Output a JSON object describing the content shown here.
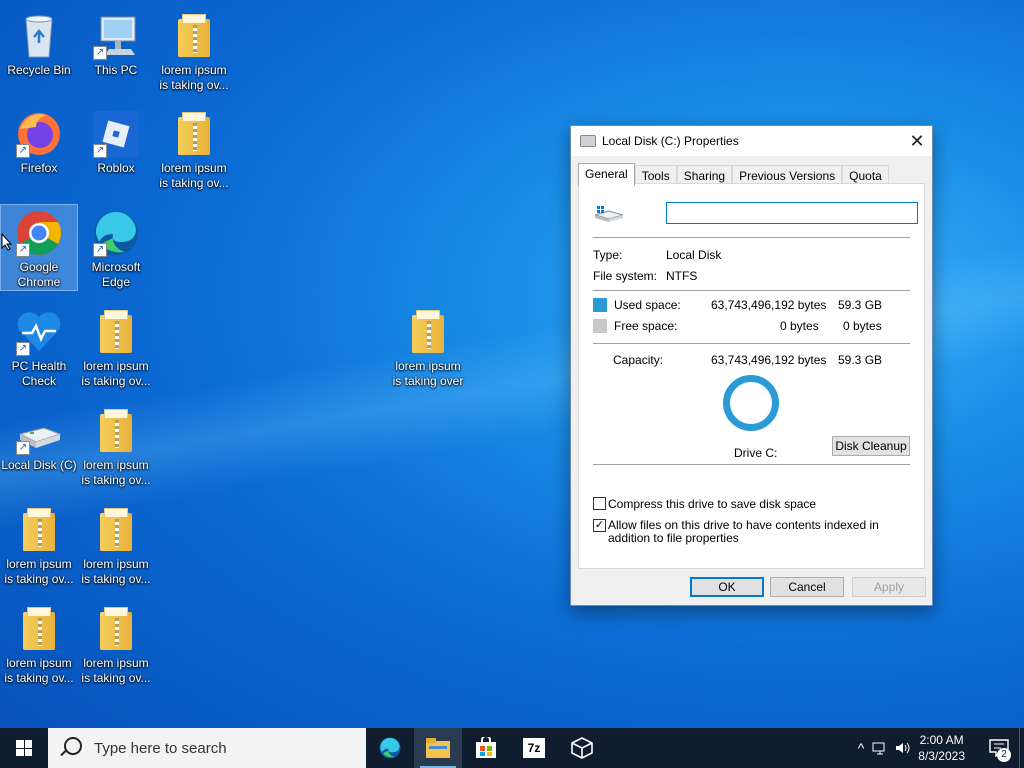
{
  "desktop": {
    "icons": [
      {
        "label": "Recycle Bin"
      },
      {
        "label": "This PC"
      },
      {
        "label": "lorem ipsum\nis taking ov..."
      },
      {
        "label": "Firefox"
      },
      {
        "label": "Roblox"
      },
      {
        "label": "lorem ipsum\nis taking ov..."
      },
      {
        "label": "Google\nChrome"
      },
      {
        "label": "Microsoft\nEdge"
      },
      {
        "label": "PC Health\nCheck"
      },
      {
        "label": "lorem ipsum\nis taking ov..."
      },
      {
        "label": "lorem ipsum\nis taking over"
      },
      {
        "label": "Local Disk (C)"
      },
      {
        "label": "lorem ipsum\nis taking ov..."
      },
      {
        "label": "lorem ipsum\nis taking ov..."
      },
      {
        "label": "lorem ipsum\nis taking ov..."
      },
      {
        "label": "lorem ipsum\nis taking ov..."
      },
      {
        "label": "lorem ipsum\nis taking ov..."
      }
    ]
  },
  "dialog": {
    "title": "Local Disk (C:) Properties",
    "close": "✕",
    "tabs": [
      "General",
      "Tools",
      "Sharing",
      "Previous Versions",
      "Quota"
    ],
    "name_value": "",
    "type_label": "Type:",
    "type_value": "Local Disk",
    "fs_label": "File system:",
    "fs_value": "NTFS",
    "used_label": "Used space:",
    "used_bytes": "63,743,496,192 bytes",
    "used_gb": "59.3 GB",
    "free_label": "Free space:",
    "free_bytes": "0 bytes",
    "free_gb": "0 bytes",
    "capacity_label": "Capacity:",
    "capacity_bytes": "63,743,496,192 bytes",
    "capacity_gb": "59.3 GB",
    "drive_label": "Drive C:",
    "cleanup_button": "Disk Cleanup",
    "compress_label": "Compress this drive to save disk space",
    "index_label": "Allow files on this drive to have contents indexed in addition to file properties",
    "ok": "OK",
    "cancel": "Cancel",
    "apply": "Apply",
    "used_color": "#2b9bd8",
    "free_color": "#c8c8c8"
  },
  "taskbar": {
    "search_placeholder": "Type here to search",
    "time": "2:00 AM",
    "date": "8/3/2023",
    "notif_count": "2",
    "apps": [
      "edge-icon",
      "file-explorer-icon",
      "store-icon",
      "7zip-icon",
      "3d-viewer-icon"
    ]
  }
}
